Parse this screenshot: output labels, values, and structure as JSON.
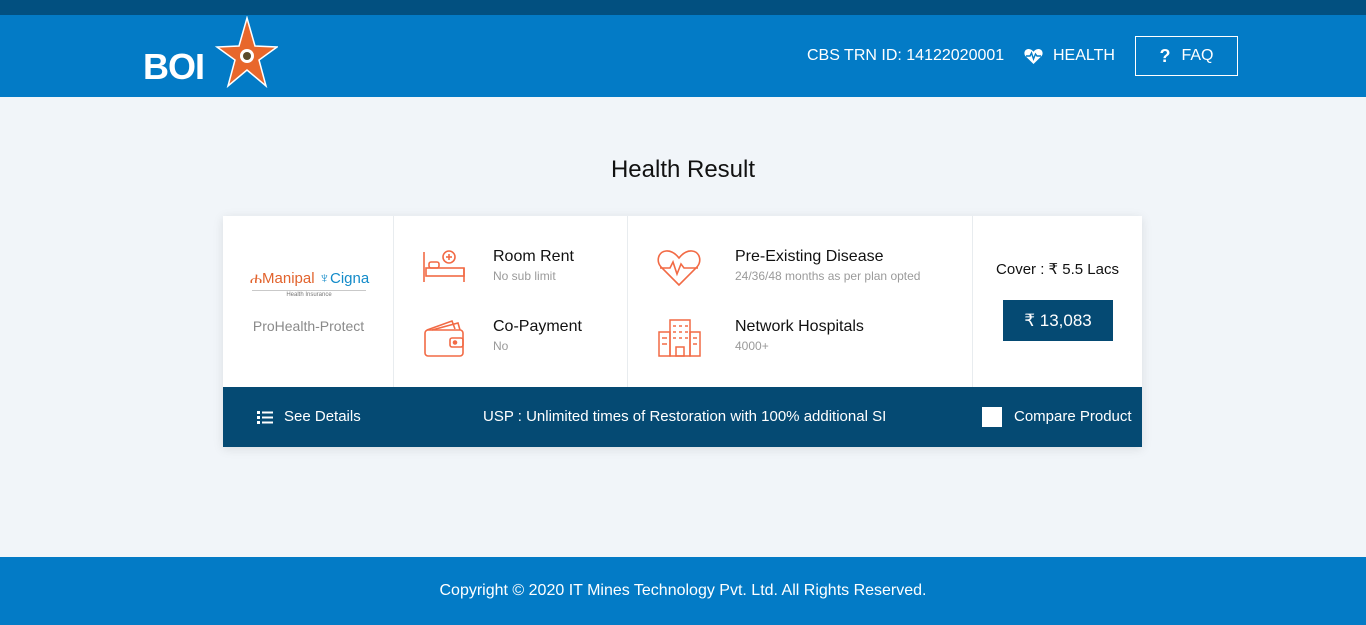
{
  "header": {
    "logo_text": "BOI",
    "trn": "CBS TRN ID: 14122020001",
    "health_label": "HEALTH",
    "faq_label": "FAQ"
  },
  "page": {
    "title": "Health Result"
  },
  "result": {
    "insurer_brand_a": "Manipal",
    "insurer_brand_b": "Cigna",
    "insurer_sub": "Health Insurance",
    "plan_name": "ProHealth-Protect",
    "features": [
      {
        "title": "Room Rent",
        "value": "No sub limit",
        "icon": "bed-icon"
      },
      {
        "title": "Co-Payment",
        "value": "No",
        "icon": "wallet-icon"
      },
      {
        "title": "Pre-Existing Disease",
        "value": "24/36/48 months as per plan opted",
        "icon": "heart-pulse-icon"
      },
      {
        "title": "Network Hospitals",
        "value": "4000+",
        "icon": "hospital-icon"
      }
    ],
    "cover": "Cover : ₹ 5.5 Lacs",
    "premium": "₹ 13,083",
    "see_details": "See Details",
    "usp": "USP : Unlimited times of Restoration with 100% additional SI",
    "compare": "Compare Product"
  },
  "footer": {
    "copyright": "Copyright © 2020 IT Mines Technology Pvt. Ltd. All Rights Reserved."
  },
  "colors": {
    "header_blue": "#037bc6",
    "dark_blue": "#054a73",
    "icon_orange": "#f26a45",
    "logo_star": "#e8672b"
  }
}
